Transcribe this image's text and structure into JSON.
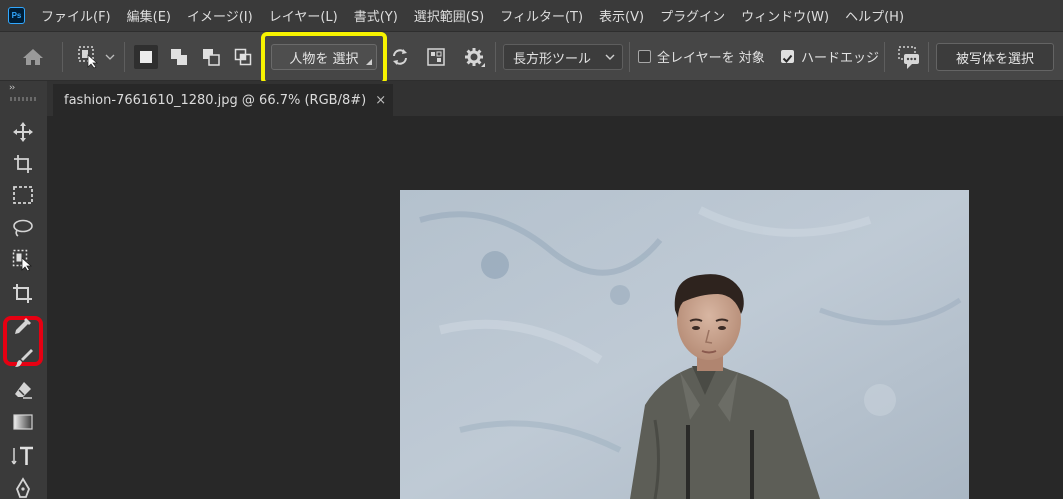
{
  "app": {
    "logo_text": "Ps"
  },
  "menu": [
    "ファイル(F)",
    "編集(E)",
    "イメージ(I)",
    "レイヤー(L)",
    "書式(Y)",
    "選択範囲(S)",
    "フィルター(T)",
    "表示(V)",
    "プラグイン",
    "ウィンドウ(W)",
    "ヘルプ(H)"
  ],
  "options": {
    "select_subject_label": "人物を 選択",
    "tool_dropdown_value": "長方形ツール",
    "sample_all_layers_label": "全レイヤーを 対象",
    "sample_all_layers_checked": false,
    "hard_edge_label": "ハードエッジ",
    "hard_edge_checked": true,
    "select_object_label": "被写体を選択"
  },
  "document": {
    "tab_title": "fashion-7661610_1280.jpg @ 66.7% (RGB/8#)",
    "close_glyph": "×"
  },
  "toolbar": {
    "collapse_glyph": "››"
  },
  "colors": {
    "highlight_yellow": "#f7f300",
    "highlight_red": "#e60012",
    "ps_blue": "#31a8ff"
  }
}
